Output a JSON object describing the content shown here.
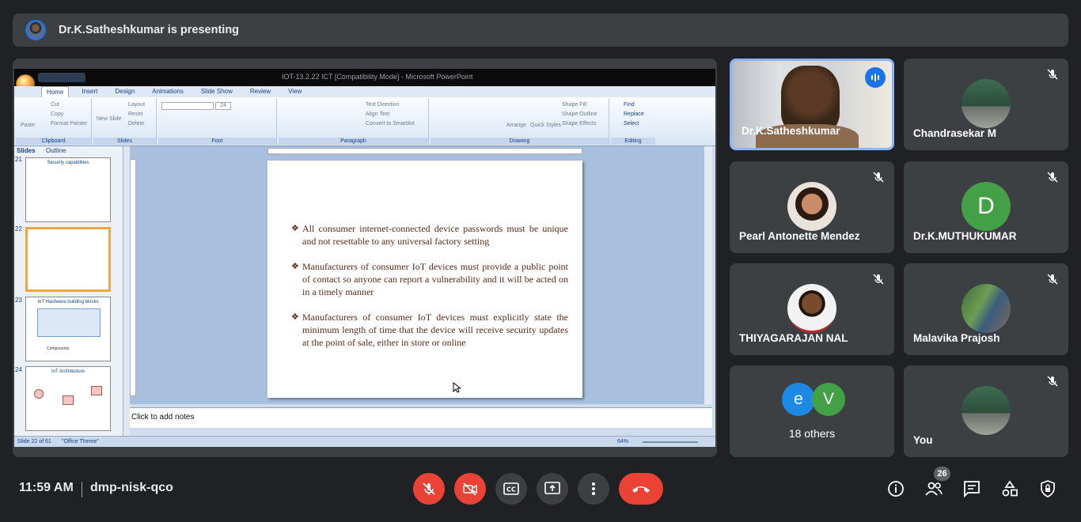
{
  "banner": {
    "text": "Dr.K.Satheshkumar is presenting",
    "avatar_icon": "presenter-avatar"
  },
  "ppt": {
    "window_title": "IOT-13.2.22 ICT [Compatibility Mode] - Microsoft PowerPoint",
    "tabs": [
      "Home",
      "Insert",
      "Design",
      "Animations",
      "Slide Show",
      "Review",
      "View"
    ],
    "active_tab": "Home",
    "groups": {
      "clipboard": {
        "label": "Clipboard",
        "items": [
          "Paste",
          "Cut",
          "Copy",
          "Format Painter"
        ]
      },
      "slides": {
        "label": "Slides",
        "items": [
          "New Slide",
          "Layout",
          "Reset",
          "Delete"
        ]
      },
      "font": {
        "label": "Font",
        "size": "24"
      },
      "paragraph": {
        "label": "Paragraph",
        "items": [
          "Text Direction",
          "Align Text",
          "Convert to SmartArt"
        ]
      },
      "drawing": {
        "label": "Drawing",
        "items": [
          "Arrange",
          "Quick Styles",
          "Shape Fill",
          "Shape Outline",
          "Shape Effects"
        ]
      },
      "editing": {
        "label": "Editing",
        "items": [
          "Find",
          "Replace",
          "Select"
        ]
      }
    },
    "pane_tabs": [
      "Slides",
      "Outline"
    ],
    "thumbnails": [
      {
        "num": "21",
        "title": "Security capabilities"
      },
      {
        "num": "22",
        "title": ""
      },
      {
        "num": "23",
        "title": "IoT Hardware building blocks",
        "sub": "Components"
      },
      {
        "num": "24",
        "title": "IoT Architecture"
      }
    ],
    "slide_bullets": [
      "All consumer internet-connected device passwords must be unique and not resettable to any universal factory setting",
      "Manufacturers of consumer IoT devices must provide a public point of contact so anyone can report a vulnerability and it will be acted on in a timely manner",
      "Manufacturers of consumer IoT devices must explicitly state the minimum length of time that the device will receive security updates at the point of sale, either in store or online"
    ],
    "notes_placeholder": "Click to add notes",
    "status": {
      "slide_of": "Slide 22 of 61",
      "theme": "\"Office Theme\"",
      "zoom": "64%"
    }
  },
  "participants": [
    {
      "name": "Dr.K.Satheshkumar",
      "speaking": true
    },
    {
      "name": "Chandrasekar M",
      "muted": true
    },
    {
      "name": "Pearl Antonette Mendez",
      "muted": true
    },
    {
      "name": "Dr.K.MUTHUKUMAR",
      "muted": true,
      "initial": "D",
      "color": "#43a047"
    },
    {
      "name": "THIYAGARAJAN NAL",
      "muted": true
    },
    {
      "name": "Malavika Prajosh",
      "muted": true
    },
    {
      "name": "18 others",
      "chips": [
        {
          "initial": "e",
          "color": "#1e88e5"
        },
        {
          "initial": "V",
          "color": "#43a047"
        }
      ]
    },
    {
      "name": "You",
      "muted": true
    }
  ],
  "bottom": {
    "time": "11:59 AM",
    "meeting_code": "dmp-nisk-qco",
    "people_count": "26"
  },
  "colors": {
    "bg": "#202124",
    "tile": "#3c4043",
    "danger": "#ea4335",
    "speaking": "#1a73e8"
  }
}
